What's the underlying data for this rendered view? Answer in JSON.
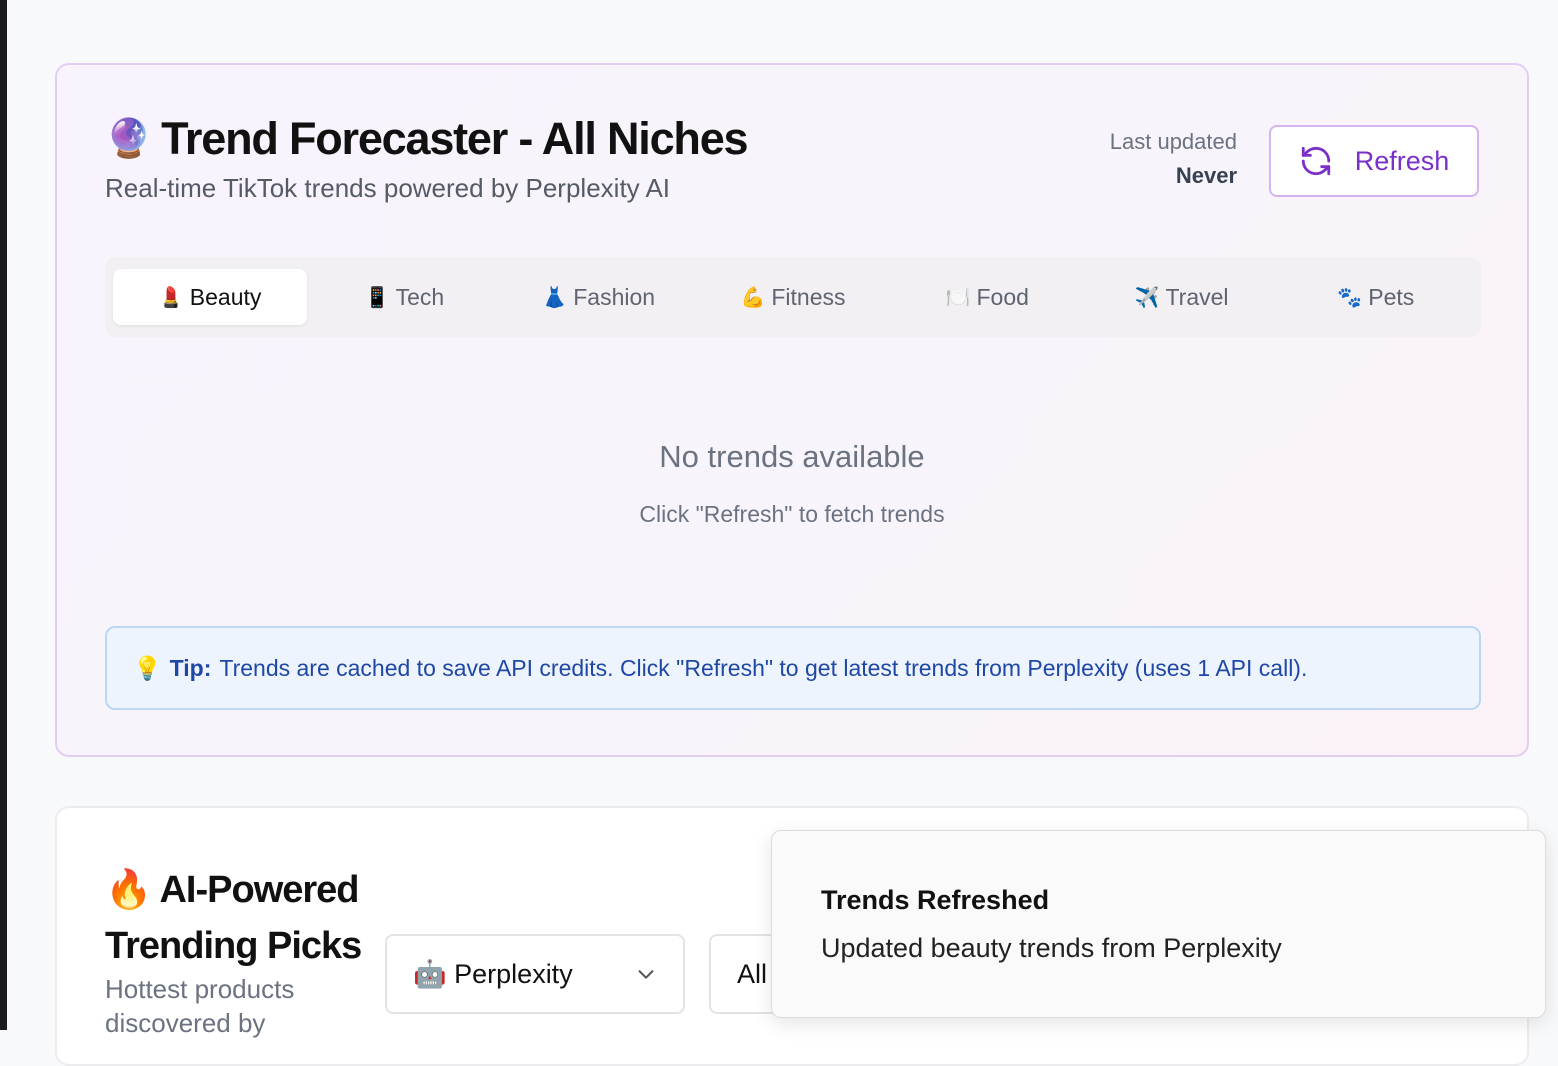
{
  "forecaster": {
    "title_icon": "crystal-ball-icon",
    "title": "Trend Forecaster - All Niches",
    "subtitle": "Real-time TikTok trends powered by Perplexity AI",
    "last_updated_label": "Last updated",
    "last_updated_value": "Never",
    "refresh_label": "Refresh",
    "tabs": [
      {
        "icon": "💄",
        "label": "Beauty",
        "active": true
      },
      {
        "icon": "📱",
        "label": "Tech"
      },
      {
        "icon": "👗",
        "label": "Fashion"
      },
      {
        "icon": "💪",
        "label": "Fitness"
      },
      {
        "icon": "🍽️",
        "label": "Food"
      },
      {
        "icon": "✈️",
        "label": "Travel"
      },
      {
        "icon": "🐾",
        "label": "Pets"
      }
    ],
    "empty_title": "No trends available",
    "empty_subtitle": "Click \"Refresh\" to fetch trends",
    "tip_label": "Tip:",
    "tip_text": "Trends are cached to save API credits. Click \"Refresh\" to get latest trends from Perplexity (uses 1 API call)."
  },
  "picks": {
    "title": "AI-Powered Trending Picks",
    "subtitle": "Hottest products discovered by",
    "model_select": {
      "icon": "🤖",
      "value": "Perplexity"
    },
    "category_select": {
      "value": "All"
    }
  },
  "toast": {
    "title": "Trends Refreshed",
    "message": "Updated beauty trends from Perplexity"
  },
  "colors": {
    "accent": "#7b30c8",
    "tip_text": "#1f47a6",
    "card_border": "#e2cdf3"
  }
}
